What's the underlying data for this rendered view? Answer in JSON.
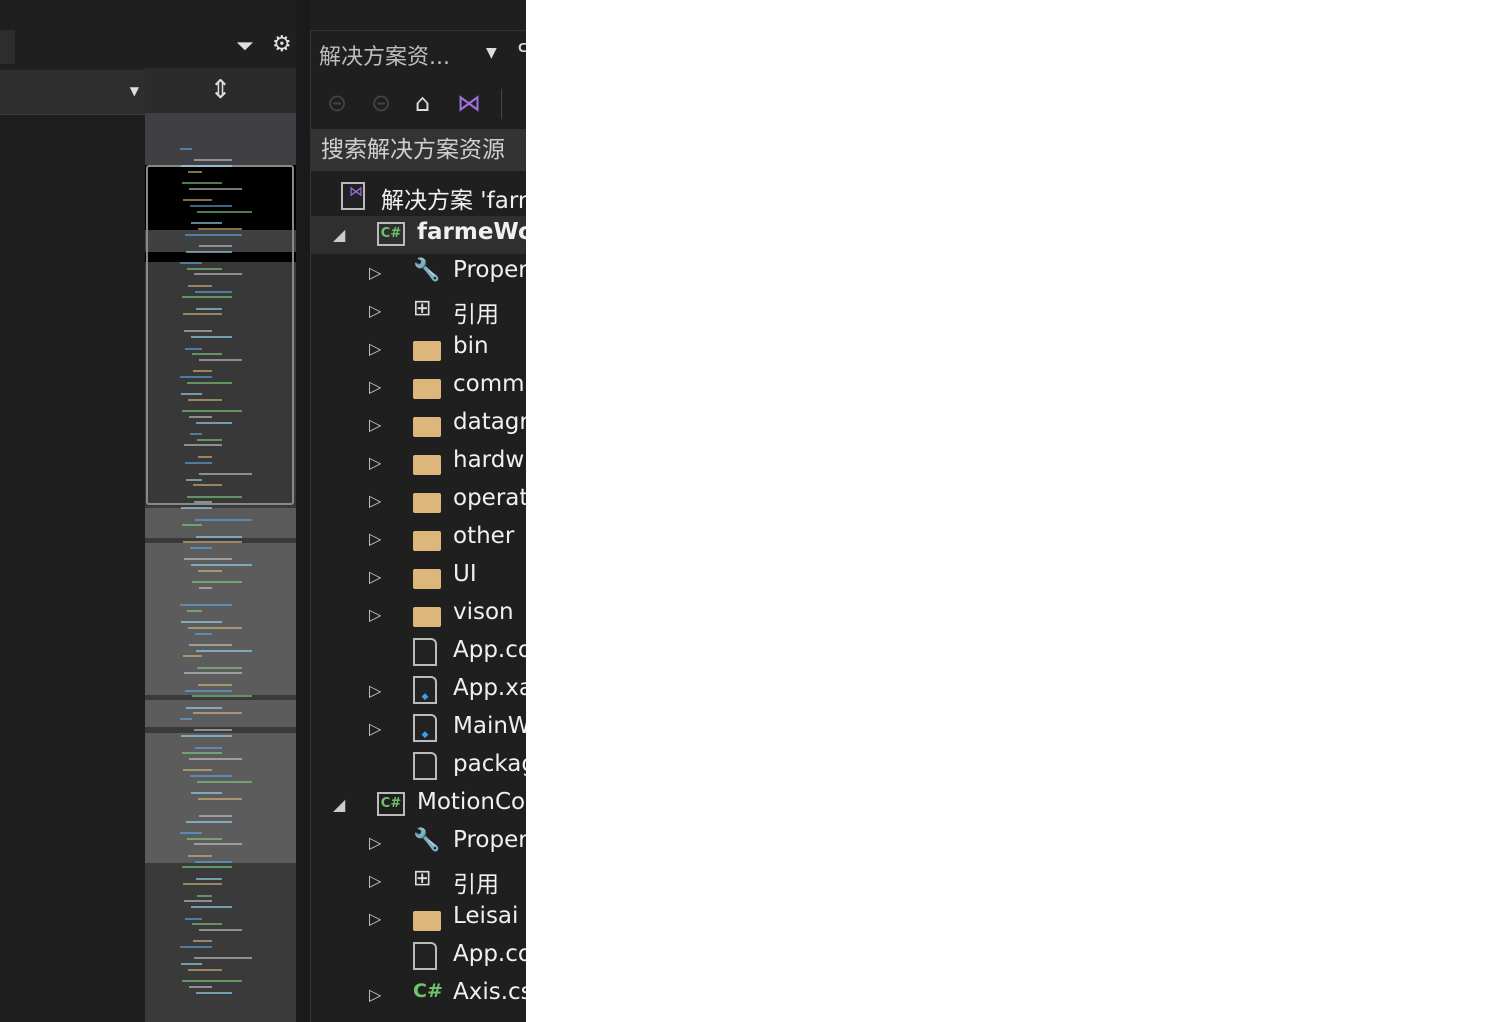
{
  "toolbar": {
    "filter_icon": "filter-icon",
    "settings_icon": "gear-icon"
  },
  "minimap": {
    "split_icon": "split-icon",
    "scroll_up_icon": "arrow-up-icon"
  },
  "solution_explorer": {
    "title": "解决方案资...",
    "search_placeholder": "搜索解决方案资源",
    "tree": [
      {
        "label": "解决方案 'farr",
        "type": "solution",
        "level": 0,
        "expander": "none"
      },
      {
        "label": "farmeWo",
        "type": "csproj",
        "level": 1,
        "expander": "expanded",
        "bold": true,
        "selected": true
      },
      {
        "label": "Proper",
        "type": "properties",
        "level": 2,
        "expander": "collapsed"
      },
      {
        "label": "引用",
        "type": "references",
        "level": 2,
        "expander": "collapsed"
      },
      {
        "label": "bin",
        "type": "folder",
        "level": 2,
        "expander": "collapsed"
      },
      {
        "label": "comm",
        "type": "folder",
        "level": 2,
        "expander": "collapsed"
      },
      {
        "label": "datagr",
        "type": "folder",
        "level": 2,
        "expander": "collapsed"
      },
      {
        "label": "hardw",
        "type": "folder",
        "level": 2,
        "expander": "collapsed"
      },
      {
        "label": "operat",
        "type": "folder",
        "level": 2,
        "expander": "collapsed"
      },
      {
        "label": "other",
        "type": "folder",
        "level": 2,
        "expander": "collapsed"
      },
      {
        "label": "UI",
        "type": "folder",
        "level": 2,
        "expander": "collapsed"
      },
      {
        "label": "vison",
        "type": "folder",
        "level": 2,
        "expander": "collapsed"
      },
      {
        "label": "App.co",
        "type": "config",
        "level": 2,
        "expander": "none"
      },
      {
        "label": "App.xa",
        "type": "xaml",
        "level": 2,
        "expander": "collapsed"
      },
      {
        "label": "MainW",
        "type": "xaml",
        "level": 2,
        "expander": "collapsed"
      },
      {
        "label": "packag",
        "type": "config",
        "level": 2,
        "expander": "none"
      },
      {
        "label": "MotionCo",
        "type": "csproj",
        "level": 1,
        "expander": "expanded"
      },
      {
        "label": "Proper",
        "type": "properties",
        "level": 2,
        "expander": "collapsed"
      },
      {
        "label": "引用",
        "type": "references",
        "level": 2,
        "expander": "collapsed"
      },
      {
        "label": "Leisai",
        "type": "folder",
        "level": 2,
        "expander": "collapsed"
      },
      {
        "label": "App.co",
        "type": "config",
        "level": 2,
        "expander": "none"
      },
      {
        "label": "Axis.cs",
        "type": "cs",
        "level": 2,
        "expander": "collapsed"
      }
    ]
  }
}
